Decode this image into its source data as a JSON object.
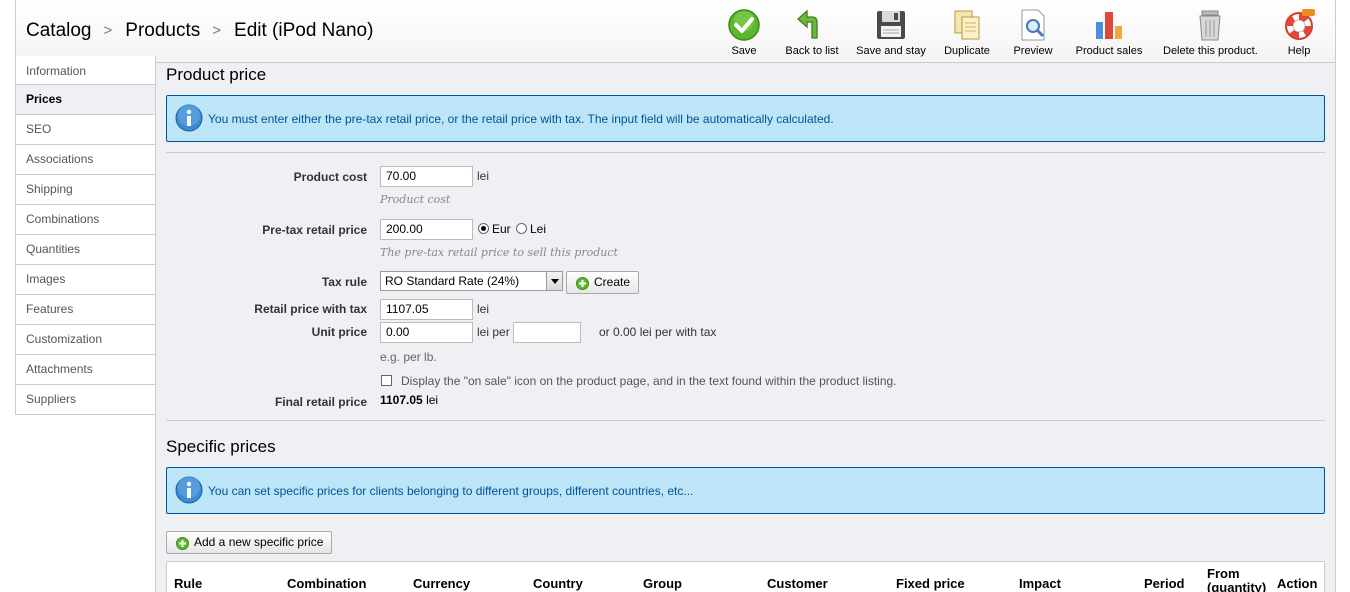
{
  "breadcrumb": {
    "items": [
      "Catalog",
      "Products",
      "Edit (iPod Nano)"
    ],
    "separator": ">"
  },
  "toolbar": {
    "buttons": [
      {
        "label": "Save",
        "icon": "save-check-icon"
      },
      {
        "label": "Back to list",
        "icon": "back-arrow-icon"
      },
      {
        "label": "Save and stay",
        "icon": "floppy-disk-icon"
      },
      {
        "label": "Duplicate",
        "icon": "duplicate-pages-icon"
      },
      {
        "label": "Preview",
        "icon": "preview-magnifier-icon"
      },
      {
        "label": "Product sales",
        "icon": "bar-chart-icon"
      },
      {
        "label": "Delete this product.",
        "icon": "trash-can-icon"
      },
      {
        "label": "Help",
        "icon": "lifebuoy-icon"
      }
    ]
  },
  "sidebar": {
    "items": [
      {
        "label": "Information"
      },
      {
        "label": "Prices",
        "active": true
      },
      {
        "label": "SEO"
      },
      {
        "label": "Associations"
      },
      {
        "label": "Shipping"
      },
      {
        "label": "Combinations"
      },
      {
        "label": "Quantities"
      },
      {
        "label": "Images"
      },
      {
        "label": "Features"
      },
      {
        "label": "Customization"
      },
      {
        "label": "Attachments"
      },
      {
        "label": "Suppliers"
      }
    ]
  },
  "product_price": {
    "title": "Product price",
    "info": "You must enter either the pre-tax retail price, or the retail price with tax. The input field will be automatically calculated.",
    "product_cost": {
      "label": "Product cost",
      "value": "70.00",
      "unit": "lei",
      "hint": "Product cost"
    },
    "pretax": {
      "label": "Pre-tax retail price",
      "value": "200.00",
      "hint": "The pre-tax retail price to sell this product",
      "currency_options": [
        "Eur",
        "Lei"
      ],
      "selected": "Eur"
    },
    "tax_rule": {
      "label": "Tax rule",
      "value": "RO Standard Rate (24%)",
      "create_label": "Create"
    },
    "retail_with_tax": {
      "label": "Retail price with tax",
      "value": "1107.05",
      "unit": "lei"
    },
    "unit_price": {
      "label": "Unit price",
      "value": "0.00",
      "per_label": "lei per",
      "per_value": "",
      "with_tax_text": "or 0.00 lei per with tax",
      "example": "e.g. per lb."
    },
    "on_sale": {
      "label": "Display the \"on sale\" icon on the product page, and in the text found within the product listing.",
      "checked": false
    },
    "final": {
      "label": "Final retail price",
      "value": "1107.05",
      "unit": "lei"
    }
  },
  "specific_prices": {
    "title": "Specific prices",
    "info": "You can set specific prices for clients belonging to different groups, different countries, etc...",
    "add_label": "Add a new specific price",
    "columns": [
      "Rule",
      "Combination",
      "Currency",
      "Country",
      "Group",
      "Customer",
      "Fixed price",
      "Impact",
      "Period",
      "From (quantity)",
      "Action"
    ]
  },
  "colors": {
    "info_bg": "#bde5f8",
    "info_text": "#00529b",
    "panel_bg": "#eef0f3"
  }
}
